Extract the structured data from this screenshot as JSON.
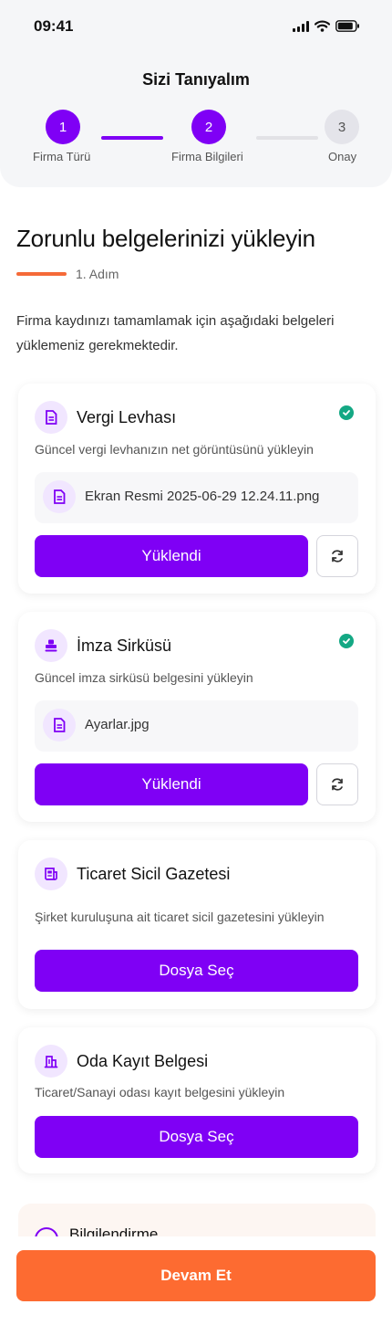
{
  "status_bar": {
    "time": "09:41"
  },
  "header": {
    "title": "Sizi Tanıyalım"
  },
  "stepper": {
    "steps": [
      {
        "number": "1",
        "label": "Firma Türü"
      },
      {
        "number": "2",
        "label": "Firma Bilgileri"
      },
      {
        "number": "3",
        "label": "Onay"
      }
    ]
  },
  "main": {
    "heading": "Zorunlu belgelerinizi yükleyin",
    "step_text": "1. Adım",
    "intro": "Firma kaydınızı tamamlamak için aşağıdaki belgeleri yüklemeniz gerekmektedir."
  },
  "documents": [
    {
      "title": "Vergi Levhası",
      "description": "Güncel vergi levhanızın net görüntüsünü yükleyin",
      "file_name": "Ekran Resmi 2025-06-29 12.24.11.png",
      "button_label": "Yüklendi",
      "icon": "document-icon"
    },
    {
      "title": "İmza Sirküsü",
      "description": "Güncel imza sirküsü belgesini yükleyin",
      "file_name": "Ayarlar.jpg",
      "button_label": "Yüklendi",
      "icon": "stamp-icon"
    },
    {
      "title": "Ticaret Sicil Gazetesi",
      "description": "Şirket kuruluşuna ait ticaret sicil gazetesini yükleyin",
      "button_label": "Dosya Seç",
      "icon": "newspaper-icon"
    },
    {
      "title": "Oda Kayıt Belgesi",
      "description": "Ticaret/Sanayi odası kayıt belgesini yükleyin",
      "button_label": "Dosya Seç",
      "icon": "building-icon"
    }
  ],
  "info": {
    "title": "Bilgilendirme"
  },
  "footer": {
    "continue_label": "Devam Et"
  },
  "colors": {
    "primary": "#7f00f5",
    "accent": "#fd6b31",
    "success": "#14a884"
  }
}
